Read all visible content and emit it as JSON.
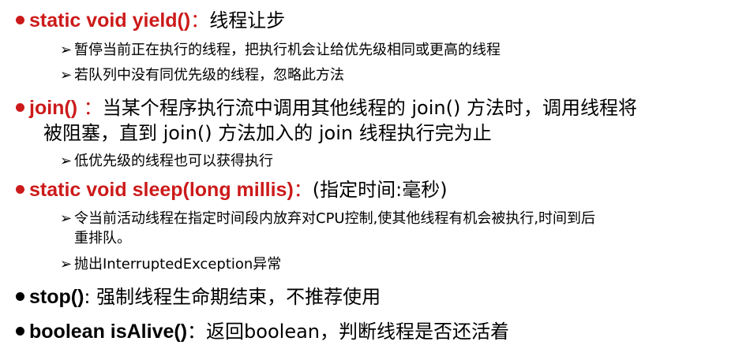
{
  "colors": {
    "accent_red": "#cc1a1a",
    "text": "#000000"
  },
  "items": [
    {
      "keyword": "static  void  yield()",
      "separator": "：",
      "desc": "线程让步",
      "subs": [
        "暂停当前正在执行的线程，把执行机会让给优先级相同或更高的线程",
        "若队列中没有同优先级的线程，忽略此方法"
      ]
    },
    {
      "keyword": "join()",
      "separator": " ：",
      "desc": "当某个程序执行流中调用其他线程的 join() 方法时，调用线程将",
      "desc_cont": "被阻塞，直到 join() 方法加入的 join 线程执行完为止",
      "subs": [
        "低优先级的线程也可以获得执行"
      ]
    },
    {
      "keyword": "static  void  sleep(long millis)",
      "separator": "：",
      "desc": "(指定时间:毫秒)",
      "subs": [
        "令当前活动线程在指定时间段内放弃对CPU控制,使其他线程有机会被执行,时间到后",
        "重排队。",
        "抛出InterruptedException异常"
      ]
    },
    {
      "keyword": "stop()",
      "separator": ": ",
      "desc": "强制线程生命期结束，不推荐使用"
    },
    {
      "keyword": "boolean isAlive()",
      "separator": "：",
      "desc": "返回boolean，判断线程是否还活着"
    }
  ],
  "arrow_glyph": "➢"
}
